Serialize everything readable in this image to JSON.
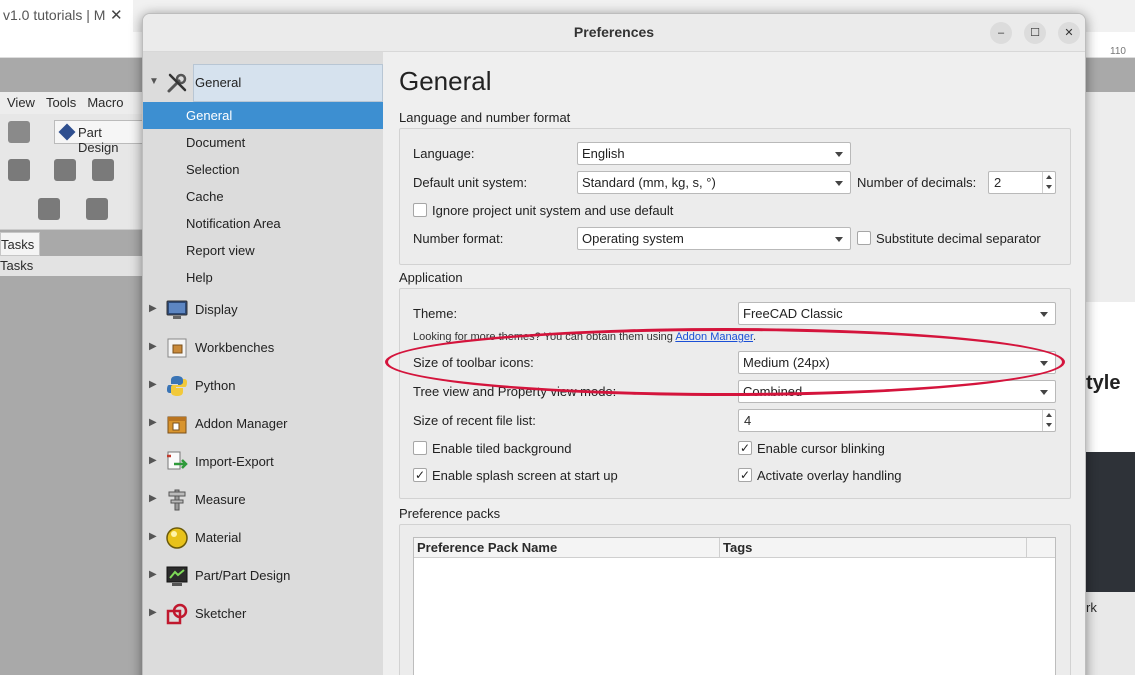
{
  "browser": {
    "tab_title": "v1.0 tutorials | M",
    "tab_close": "✕",
    "addr_right": "110"
  },
  "background_app": {
    "menu": [
      "View",
      "Tools",
      "Macro"
    ],
    "workbench_button": "Part Design",
    "tasks_tab": "Tasks",
    "tasks_header": "Tasks",
    "right_text_style": "tyle",
    "right_text_low": "rk"
  },
  "dialog": {
    "title": "Preferences",
    "minimize": "–",
    "maximize": "☐",
    "close": "✕"
  },
  "sidebar": {
    "categories": [
      {
        "label": "General",
        "icon": "wrench-screwdriver-icon",
        "expanded": true
      },
      {
        "label": "Display",
        "icon": "monitor-icon"
      },
      {
        "label": "Workbenches",
        "icon": "package-icon"
      },
      {
        "label": "Python",
        "icon": "python-icon"
      },
      {
        "label": "Addon Manager",
        "icon": "addon-box-icon"
      },
      {
        "label": "Import-Export",
        "icon": "import-export-icon"
      },
      {
        "label": "Measure",
        "icon": "caliper-icon"
      },
      {
        "label": "Material",
        "icon": "material-sphere-icon"
      },
      {
        "label": "Part/Part Design",
        "icon": "part-design-icon"
      },
      {
        "label": "Sketcher",
        "icon": "sketcher-icon"
      }
    ],
    "general_children": [
      "General",
      "Document",
      "Selection",
      "Cache",
      "Notification Area",
      "Report view",
      "Help"
    ]
  },
  "page": {
    "title": "General",
    "language_group": {
      "label": "Language and number format",
      "language_label": "Language:",
      "language_value": "English",
      "unit_label": "Default unit system:",
      "unit_value": "Standard (mm, kg, s, °)",
      "decimals_label": "Number of decimals:",
      "decimals_value": "2",
      "ignore_unit_label": "Ignore project unit system and use default",
      "ignore_unit_checked": false,
      "number_format_label": "Number format:",
      "number_format_value": "Operating system",
      "substitute_label": "Substitute decimal separator",
      "substitute_checked": false
    },
    "application_group": {
      "label": "Application",
      "theme_label": "Theme:",
      "theme_value": "FreeCAD Classic",
      "themes_hint": "Looking for more themes? You can obtain them using ",
      "themes_link": "Addon Manager",
      "themes_hint_end": ".",
      "toolbar_icons_label": "Size of toolbar icons:",
      "toolbar_icons_value": "Medium (24px)",
      "tree_mode_label": "Tree view and Property view mode:",
      "tree_mode_value": "Combined",
      "recent_files_label": "Size of recent file list:",
      "recent_files_value": "4",
      "tiled_bg_label": "Enable tiled background",
      "tiled_bg_checked": false,
      "cursor_blink_label": "Enable cursor blinking",
      "cursor_blink_checked": true,
      "splash_label": "Enable splash screen at start up",
      "splash_checked": true,
      "overlay_label": "Activate overlay handling",
      "overlay_checked": true
    },
    "packs_group": {
      "label": "Preference packs",
      "columns": [
        "Preference Pack Name",
        "Tags"
      ],
      "rows": []
    }
  },
  "check_glyph": "✓",
  "arrow_expanded": "▼",
  "arrow_collapsed": "▶"
}
